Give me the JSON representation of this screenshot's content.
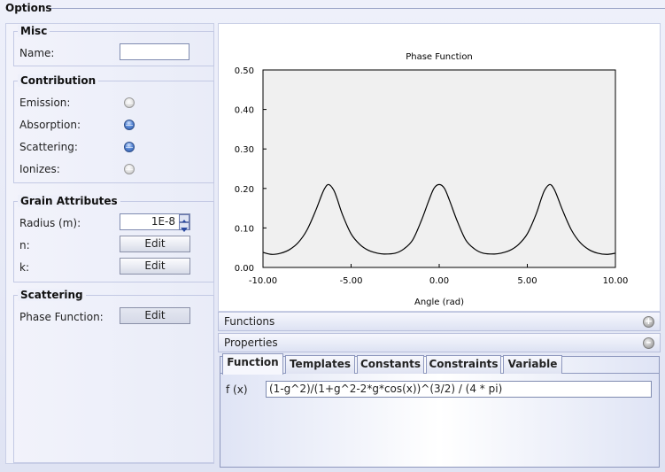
{
  "window": {
    "title": "Options"
  },
  "misc": {
    "title": "Misc",
    "name_label": "Name:",
    "name_value": ""
  },
  "contribution": {
    "title": "Contribution",
    "items": [
      {
        "label": "Emission:",
        "selected": false
      },
      {
        "label": "Absorption:",
        "selected": true
      },
      {
        "label": "Scattering:",
        "selected": true
      },
      {
        "label": "Ionizes:",
        "selected": false
      }
    ]
  },
  "grain": {
    "title": "Grain Attributes",
    "radius_label": "Radius (m):",
    "radius_value": "1E-8",
    "n_label": "n:",
    "k_label": "k:",
    "edit_label": "Edit"
  },
  "scattering": {
    "title": "Scattering",
    "phase_label": "Phase Function:",
    "edit_label": "Edit"
  },
  "chart_data": {
    "type": "line",
    "title": "Phase Function",
    "xlabel": "Angle (rad)",
    "ylabel": "",
    "xlim": [
      -10,
      10
    ],
    "ylim": [
      0,
      0.5
    ],
    "x_ticks": [
      "-10.00",
      "-5.00",
      "0.00",
      "5.00",
      "10.00"
    ],
    "y_ticks": [
      "0.00",
      "0.10",
      "0.20",
      "0.30",
      "0.40",
      "0.50"
    ],
    "grid": false,
    "series": [
      {
        "color": "#000000",
        "x": [
          -10.0,
          -9.5,
          -9.0,
          -8.5,
          -8.0,
          -7.5,
          -7.0,
          -6.7,
          -6.5,
          -6.28,
          -6.0,
          -5.8,
          -5.5,
          -5.0,
          -4.5,
          -4.0,
          -3.5,
          -3.14,
          -2.5,
          -2.0,
          -1.5,
          -1.0,
          -0.6,
          -0.3,
          0.0,
          0.3,
          0.6,
          1.0,
          1.5,
          2.0,
          2.5,
          3.14,
          3.5,
          4.0,
          4.5,
          5.0,
          5.5,
          5.8,
          6.0,
          6.28,
          6.5,
          6.7,
          7.0,
          7.5,
          8.0,
          8.5,
          9.0,
          9.5,
          10.0
        ],
        "y": [
          0.038,
          0.033,
          0.036,
          0.045,
          0.063,
          0.095,
          0.145,
          0.18,
          0.2,
          0.21,
          0.197,
          0.175,
          0.135,
          0.085,
          0.058,
          0.043,
          0.036,
          0.034,
          0.036,
          0.047,
          0.07,
          0.12,
          0.168,
          0.2,
          0.21,
          0.2,
          0.168,
          0.12,
          0.07,
          0.047,
          0.036,
          0.034,
          0.036,
          0.043,
          0.058,
          0.085,
          0.135,
          0.175,
          0.197,
          0.21,
          0.2,
          0.18,
          0.145,
          0.095,
          0.063,
          0.045,
          0.036,
          0.033,
          0.036
        ]
      }
    ]
  },
  "functions_panel": {
    "label": "Functions",
    "icon": "plus-icon"
  },
  "properties_panel": {
    "label": "Properties",
    "icon": "minus-icon"
  },
  "tabs": [
    {
      "label": "Function",
      "active": true
    },
    {
      "label": "Templates",
      "active": false
    },
    {
      "label": "Constants",
      "active": false
    },
    {
      "label": "Constraints",
      "active": false
    },
    {
      "label": "Variable",
      "active": false
    }
  ],
  "function_editor": {
    "label": "f (x)",
    "value": "(1-g^2)/(1+g^2-2*g*cos(x))^(3/2) / (4 * pi)"
  }
}
